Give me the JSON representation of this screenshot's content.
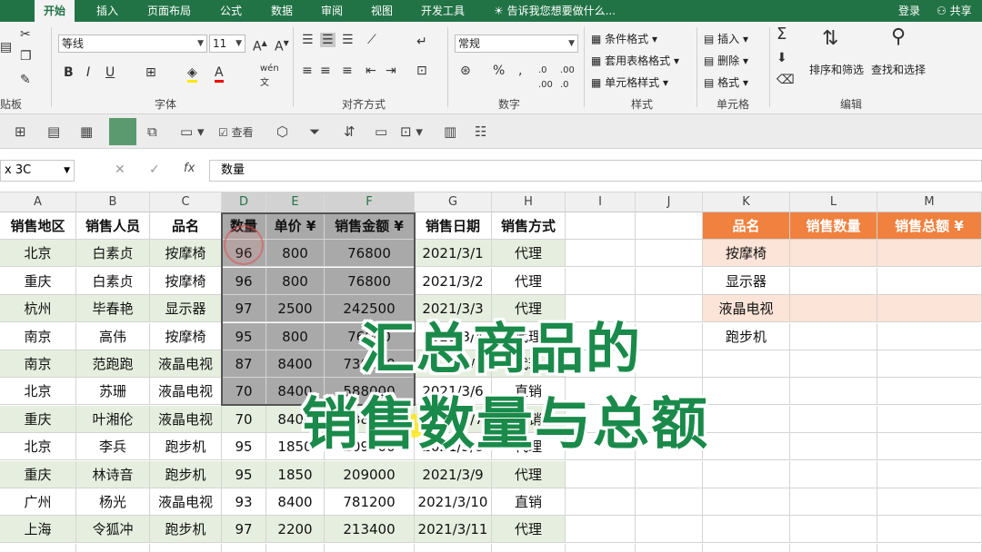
{
  "tabs": [
    "开始",
    "插入",
    "页面布局",
    "公式",
    "数据",
    "审阅",
    "视图",
    "开发工具"
  ],
  "tell_me": "告诉我您想要做什么...",
  "login": "登录",
  "share": "共享",
  "ribbon": {
    "clipboard_label": "贴板",
    "font_name": "等线",
    "font_size": "11",
    "font_label": "字体",
    "align_label": "对齐方式",
    "number_format": "常规",
    "number_label": "数字",
    "cond_format": "条件格式",
    "table_format": "套用表格格式",
    "cell_style": "单元格样式",
    "styles_label": "样式",
    "insert": "插入",
    "delete": "删除",
    "format": "格式",
    "cells_label": "单元格",
    "sort_filter": "排序和筛选",
    "find_select": "查找和选择",
    "edit_label": "编辑",
    "view_label": "查看",
    "wen_label": "wén"
  },
  "formula_bar": {
    "name_box": "x 3C",
    "formula": "数量"
  },
  "columns": [
    "A",
    "B",
    "C",
    "D",
    "E",
    "F",
    "G",
    "H",
    "I",
    "J",
    "K",
    "L",
    "M"
  ],
  "table": {
    "headers": [
      "销售地区",
      "销售人员",
      "品名",
      "数量",
      "单价 ¥",
      "销售金额 ¥",
      "销售日期",
      "销售方式"
    ],
    "rows": [
      [
        "北京",
        "白素贞",
        "按摩椅",
        "96",
        "800",
        "76800",
        "2021/3/1",
        "代理"
      ],
      [
        "重庆",
        "白素贞",
        "按摩椅",
        "96",
        "800",
        "76800",
        "2021/3/2",
        "代理"
      ],
      [
        "杭州",
        "毕春艳",
        "显示器",
        "97",
        "2500",
        "242500",
        "2021/3/3",
        "代理"
      ],
      [
        "南京",
        "高伟",
        "按摩椅",
        "95",
        "800",
        "76000",
        "2021/3/4",
        "代理"
      ],
      [
        "南京",
        "范跑跑",
        "液晶电视",
        "87",
        "8400",
        "730800",
        "2021/3/5",
        "代理"
      ],
      [
        "北京",
        "苏珊",
        "液晶电视",
        "70",
        "8400",
        "588000",
        "2021/3/6",
        "直销"
      ],
      [
        "重庆",
        "叶湘伦",
        "液晶电视",
        "70",
        "8400",
        "588000",
        "2021/3/7",
        "直销"
      ],
      [
        "北京",
        "李兵",
        "跑步机",
        "95",
        "1850",
        "209000",
        "2021/3/8",
        "代理"
      ],
      [
        "重庆",
        "林诗音",
        "跑步机",
        "95",
        "1850",
        "209000",
        "2021/3/9",
        "代理"
      ],
      [
        "广州",
        "杨光",
        "液晶电视",
        "93",
        "8400",
        "781200",
        "2021/3/10",
        "直销"
      ],
      [
        "上海",
        "令狐冲",
        "跑步机",
        "97",
        "2200",
        "213400",
        "2021/3/11",
        "代理"
      ],
      [
        "",
        "",
        "",
        "",
        "",
        "",
        "",
        ""
      ]
    ]
  },
  "summary": {
    "headers": [
      "品名",
      "销售数量",
      "销售总额 ¥"
    ],
    "items": [
      "按摩椅",
      "显示器",
      "液晶电视",
      "跑步机"
    ]
  },
  "overlay": {
    "line1": "汇总商品的",
    "line2": "销售数量与总额"
  },
  "colors": {
    "brand": "#217346",
    "header_orange": "#f0813f",
    "peach": "#fde4d8",
    "row_green": "#e6efdf",
    "overlay_green": "#1a8a4a"
  }
}
